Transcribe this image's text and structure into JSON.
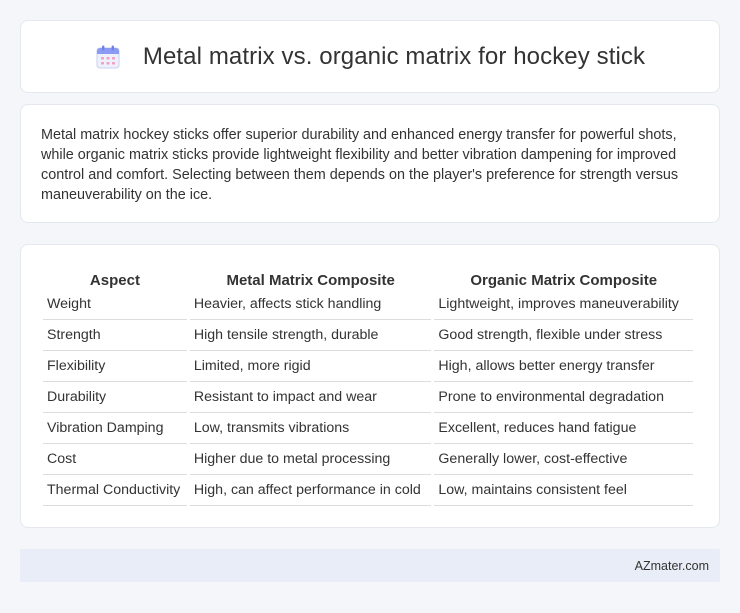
{
  "header": {
    "title": "Metal matrix vs. organic matrix for hockey stick",
    "icon": "calendar-icon"
  },
  "summary": {
    "text": "Metal matrix hockey sticks offer superior durability and enhanced energy transfer for powerful shots, while organic matrix sticks provide lightweight flexibility and better vibration dampening for improved control and comfort. Selecting between them depends on the player's preference for strength versus maneuverability on the ice."
  },
  "table": {
    "headers": [
      "Aspect",
      "Metal Matrix Composite",
      "Organic Matrix Composite"
    ],
    "rows": [
      [
        "Weight",
        "Heavier, affects stick handling",
        "Lightweight, improves maneuverability"
      ],
      [
        "Strength",
        "High tensile strength, durable",
        "Good strength, flexible under stress"
      ],
      [
        "Flexibility",
        "Limited, more rigid",
        "High, allows better energy transfer"
      ],
      [
        "Durability",
        "Resistant to impact and wear",
        "Prone to environmental degradation"
      ],
      [
        "Vibration Damping",
        "Low, transmits vibrations",
        "Excellent, reduces hand fatigue"
      ],
      [
        "Cost",
        "Higher due to metal processing",
        "Generally lower, cost-effective"
      ],
      [
        "Thermal Conductivity",
        "High, can affect performance in cold",
        "Low, maintains consistent feel"
      ]
    ]
  },
  "footer": {
    "brand": "AZmater.com"
  },
  "colors": {
    "background": "#f4f6fa",
    "card": "#ffffff",
    "footer_bg": "#e8edf7",
    "icon_accent": "#7b8cf0"
  }
}
